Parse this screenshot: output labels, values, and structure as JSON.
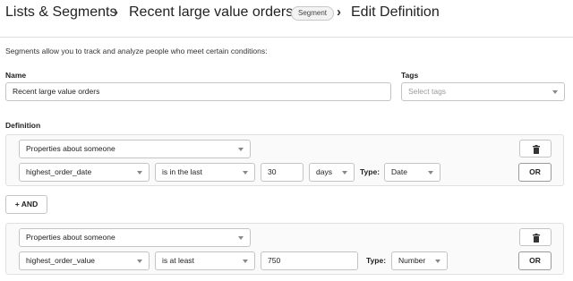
{
  "breadcrumb": {
    "lists_segments": "Lists & Segments",
    "segment_name": "Recent large value orders",
    "segment_badge": "Segment",
    "current": "Edit Definition",
    "separator": "›"
  },
  "intro_text": "Segments allow you to track and analyze people who meet certain conditions:",
  "name_field": {
    "label": "Name",
    "value": "Recent large value orders"
  },
  "tags_field": {
    "label": "Tags",
    "placeholder": "Select tags"
  },
  "definition": {
    "label": "Definition",
    "and_button": "+ AND",
    "or_button": "OR",
    "type_label": "Type:",
    "conditions": [
      {
        "category": "Properties about someone",
        "property": "highest_order_date",
        "operator": "is in the last",
        "value": "30",
        "unit": "days",
        "type": "Date"
      },
      {
        "category": "Properties about someone",
        "property": "highest_order_value",
        "operator": "is at least",
        "value": "750",
        "type": "Number"
      }
    ]
  },
  "icons": {
    "delete": "trash-icon",
    "dropdown": "chevron-down-icon"
  }
}
